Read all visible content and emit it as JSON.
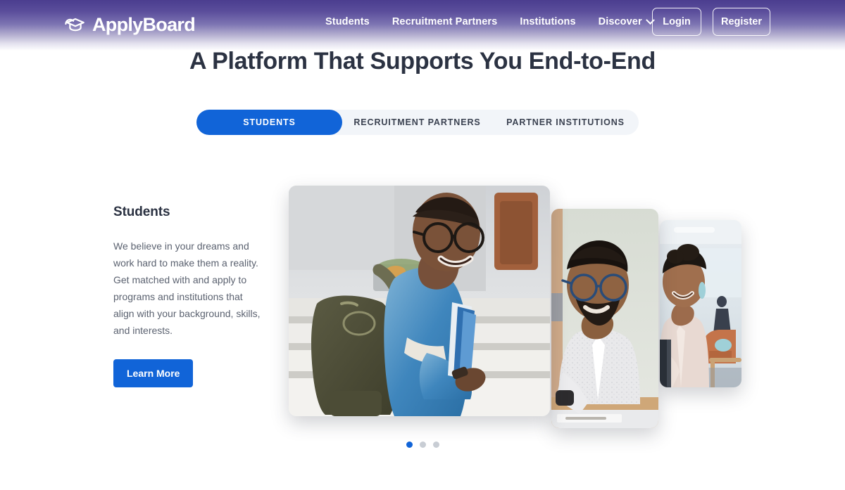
{
  "header": {
    "brand": {
      "name": "ApplyBoard",
      "icon": "graduation-cap-icon"
    },
    "nav": [
      {
        "label": "Students",
        "has_dropdown": false
      },
      {
        "label": "Recruitment Partners",
        "has_dropdown": false
      },
      {
        "label": "Institutions",
        "has_dropdown": false
      },
      {
        "label": "Discover",
        "has_dropdown": true
      }
    ],
    "login_label": "Login",
    "register_label": "Register",
    "gradient_from": "#4b3d8f",
    "gradient_to": "#ffffff"
  },
  "hero": {
    "title": "A Platform That Supports You End-to-End"
  },
  "tabs": {
    "items": [
      {
        "label": "STUDENTS",
        "active": true
      },
      {
        "label": "RECRUITMENT PARTNERS",
        "active": false
      },
      {
        "label": "PARTNER INSTITUTIONS",
        "active": false
      }
    ],
    "active_color": "#1164d8",
    "track_color": "#f2f5f9"
  },
  "panel": {
    "title": "Students",
    "body": "We believe in your dreams and work hard to make them a reality. Get matched with and apply to programs and institutions that align with your background, skills, and interests.",
    "cta_label": "Learn More",
    "cta_color": "#1164d8",
    "photos": [
      {
        "alt": "Smiling student with backpack and books on campus steps"
      },
      {
        "alt": "Man with glasses in a light shirt working at a desk"
      },
      {
        "alt": "Woman holding a notebook in a modern office lounge"
      }
    ]
  },
  "carousel": {
    "dots": [
      {
        "active": true
      },
      {
        "active": false
      },
      {
        "active": false
      }
    ],
    "active_color": "#1164d8",
    "inactive_color": "#c8cdd4"
  }
}
